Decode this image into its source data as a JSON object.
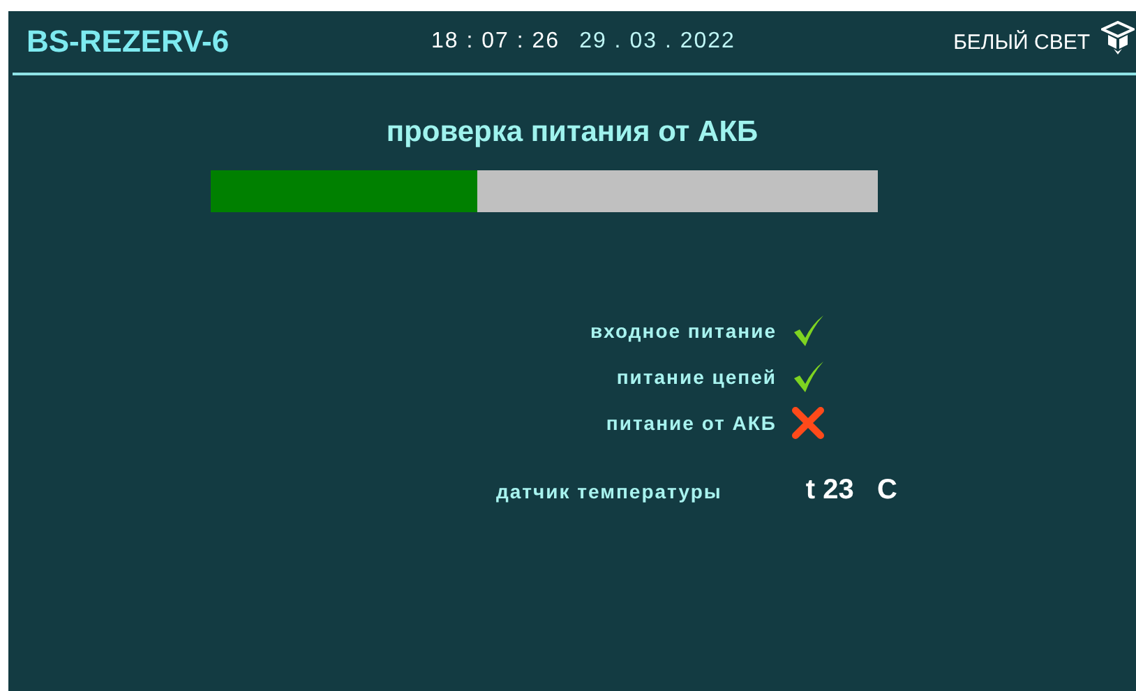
{
  "header": {
    "title": "BS-REZERV-6",
    "time": "18 : 07 : 26",
    "date": "29 . 03 . 2022",
    "brand": "БЕЛЫЙ СВЕТ"
  },
  "test": {
    "title": "проверка питания от АКБ",
    "level": 0.4
  },
  "checks": [
    {
      "label": "входное питание",
      "ok": true
    },
    {
      "label": "питание цепей",
      "ok": true
    },
    {
      "label": "питание от АКБ",
      "ok": false
    }
  ],
  "sensor": {
    "label": "датчик температуры",
    "reading": "t 23   C"
  }
}
